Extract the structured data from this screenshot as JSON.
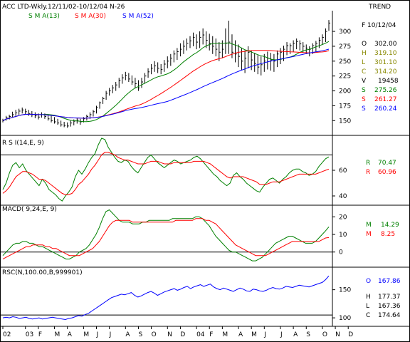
{
  "header": {
    "title": "ACC LTD-Wkly.12/11/02-10/12/04  N-26",
    "right": "TREND"
  },
  "colors": {
    "price": "#000000",
    "sma13": "#008000",
    "sma30": "#ff0000",
    "sma52": "#0000ff",
    "rsc": "#0000ff",
    "frame": "#000000",
    "background": "#ffffff"
  },
  "chart_data": [
    {
      "type": "ohlc",
      "panel": "price",
      "legend": [
        {
          "label": "S M A(13)",
          "color": "#008000"
        },
        {
          "label": "S M A(30)",
          "color": "#ff0000"
        },
        {
          "label": "S M A(52)",
          "color": "#0000ff"
        }
      ],
      "ylim": [
        130,
        330
      ],
      "y_ticks": [
        150,
        175,
        200,
        225,
        250,
        275,
        300
      ],
      "bars": [
        [
          153,
          147,
          150
        ],
        [
          158,
          150,
          155
        ],
        [
          160,
          152,
          157
        ],
        [
          165,
          155,
          160
        ],
        [
          168,
          158,
          163
        ],
        [
          170,
          160,
          166
        ],
        [
          172,
          162,
          168
        ],
        [
          170,
          160,
          165
        ],
        [
          168,
          158,
          162
        ],
        [
          166,
          156,
          160
        ],
        [
          164,
          154,
          158
        ],
        [
          162,
          152,
          156
        ],
        [
          164,
          155,
          160
        ],
        [
          162,
          153,
          157
        ],
        [
          160,
          150,
          153
        ],
        [
          158,
          147,
          150
        ],
        [
          156,
          145,
          148
        ],
        [
          153,
          143,
          146
        ],
        [
          150,
          140,
          143
        ],
        [
          148,
          139,
          142
        ],
        [
          147,
          138,
          141
        ],
        [
          150,
          140,
          146
        ],
        [
          152,
          142,
          149
        ],
        [
          155,
          145,
          151
        ],
        [
          153,
          143,
          148
        ],
        [
          156,
          147,
          153
        ],
        [
          160,
          150,
          157
        ],
        [
          164,
          153,
          160
        ],
        [
          168,
          157,
          165
        ],
        [
          175,
          162,
          172
        ],
        [
          182,
          170,
          180
        ],
        [
          190,
          178,
          187
        ],
        [
          200,
          185,
          196
        ],
        [
          205,
          192,
          200
        ],
        [
          210,
          196,
          205
        ],
        [
          215,
          200,
          210
        ],
        [
          222,
          205,
          218
        ],
        [
          228,
          212,
          222
        ],
        [
          232,
          218,
          226
        ],
        [
          230,
          215,
          220
        ],
        [
          226,
          210,
          215
        ],
        [
          222,
          205,
          212
        ],
        [
          218,
          200,
          205
        ],
        [
          222,
          205,
          215
        ],
        [
          230,
          212,
          225
        ],
        [
          238,
          222,
          232
        ],
        [
          245,
          228,
          238
        ],
        [
          250,
          232,
          242
        ],
        [
          248,
          230,
          238
        ],
        [
          245,
          228,
          236
        ],
        [
          252,
          232,
          245
        ],
        [
          258,
          238,
          250
        ],
        [
          262,
          242,
          255
        ],
        [
          268,
          248,
          262
        ],
        [
          272,
          252,
          266
        ],
        [
          280,
          258,
          270
        ],
        [
          285,
          262,
          275
        ],
        [
          288,
          268,
          280
        ],
        [
          292,
          272,
          284
        ],
        [
          298,
          275,
          290
        ],
        [
          295,
          270,
          282
        ],
        [
          300,
          272,
          290
        ],
        [
          305,
          278,
          294
        ],
        [
          300,
          272,
          285
        ],
        [
          296,
          268,
          280
        ],
        [
          292,
          262,
          275
        ],
        [
          288,
          258,
          270
        ],
        [
          282,
          250,
          265
        ],
        [
          285,
          255,
          270
        ],
        [
          305,
          262,
          280
        ],
        [
          318,
          262,
          282
        ],
        [
          295,
          255,
          265
        ],
        [
          285,
          248,
          262
        ],
        [
          278,
          240,
          258
        ],
        [
          272,
          235,
          250
        ],
        [
          268,
          230,
          255
        ],
        [
          275,
          238,
          265
        ],
        [
          268,
          235,
          252
        ],
        [
          264,
          232,
          246
        ],
        [
          260,
          228,
          240
        ],
        [
          258,
          226,
          244
        ],
        [
          262,
          232,
          250
        ],
        [
          266,
          236,
          255
        ],
        [
          264,
          234,
          252
        ],
        [
          262,
          232,
          250
        ],
        [
          268,
          240,
          262
        ],
        [
          272,
          245,
          265
        ],
        [
          276,
          250,
          270
        ],
        [
          282,
          260,
          276
        ],
        [
          280,
          262,
          276
        ],
        [
          285,
          266,
          280
        ],
        [
          288,
          270,
          283
        ],
        [
          285,
          268,
          279
        ],
        [
          282,
          264,
          275
        ],
        [
          278,
          262,
          272
        ],
        [
          275,
          258,
          270
        ],
        [
          280,
          262,
          276
        ],
        [
          284,
          266,
          280
        ],
        [
          290,
          272,
          285
        ],
        [
          295,
          278,
          290
        ],
        [
          305,
          282,
          300
        ],
        [
          319,
          301,
          314
        ]
      ],
      "current": {
        "date": "F 10/12/04",
        "O": "302.00",
        "H": "319.10",
        "L": "301.10",
        "C": "314.20",
        "V": "19458",
        "S13": "275.26",
        "S30": "261.27",
        "S52": "260.24"
      }
    },
    {
      "type": "line",
      "panel": "rsi",
      "label": "R S I(14,E, 9)",
      "ylim": [
        35,
        85
      ],
      "y_ticks": [
        40,
        60
      ],
      "reference": 72,
      "series": [
        {
          "color": "#008000",
          "values": [
            45,
            50,
            58,
            64,
            66,
            62,
            65,
            60,
            57,
            54,
            51,
            48,
            53,
            50,
            45,
            43,
            41,
            38,
            36,
            40,
            43,
            47,
            55,
            60,
            57,
            61,
            66,
            70,
            73,
            80,
            85,
            84,
            78,
            74,
            70,
            67,
            66,
            68,
            67,
            63,
            60,
            58,
            62,
            66,
            70,
            72,
            69,
            66,
            64,
            62,
            64,
            66,
            68,
            67,
            65,
            66,
            67,
            68,
            70,
            71,
            69,
            66,
            63,
            60,
            57,
            55,
            52,
            50,
            48,
            50,
            56,
            58,
            55,
            53,
            50,
            48,
            46,
            44,
            43,
            47,
            50,
            53,
            54,
            52,
            50,
            53,
            55,
            58,
            60,
            61,
            61,
            59,
            58,
            56,
            57,
            59,
            63,
            66,
            69,
            70.47
          ]
        },
        {
          "color": "#ff0000",
          "values": [
            42,
            44,
            47,
            51,
            55,
            57,
            59,
            59,
            58,
            57,
            55,
            53,
            53,
            52,
            50,
            48,
            46,
            44,
            42,
            41,
            41,
            42,
            45,
            49,
            51,
            54,
            57,
            61,
            64,
            68,
            72,
            74,
            74,
            73,
            72,
            70,
            69,
            68,
            68,
            67,
            66,
            65,
            65,
            65,
            66,
            67,
            67,
            67,
            66,
            65,
            65,
            65,
            66,
            66,
            66,
            66,
            66,
            66,
            67,
            67,
            67,
            67,
            66,
            65,
            63,
            61,
            59,
            57,
            55,
            54,
            55,
            55,
            55,
            55,
            54,
            53,
            52,
            51,
            49,
            49,
            49,
            50,
            51,
            51,
            51,
            52,
            53,
            54,
            55,
            56,
            57,
            57,
            57,
            57,
            57,
            57,
            58,
            59,
            60,
            60.96
          ]
        }
      ],
      "current": [
        {
          "label": "R",
          "value": "70.47"
        },
        {
          "label": "R",
          "value": "60.96"
        }
      ]
    },
    {
      "type": "line",
      "panel": "macd",
      "label": "MACD( 9,24,E, 9)",
      "ylim": [
        -7,
        25
      ],
      "y_ticks": [
        0,
        10,
        20
      ],
      "reference": 0,
      "series": [
        {
          "color": "#008000",
          "values": [
            -2,
            0,
            2,
            4,
            5,
            5,
            6,
            6,
            5,
            5,
            4,
            3,
            3,
            2,
            1,
            0,
            -1,
            -2,
            -3,
            -4,
            -4,
            -3,
            -2,
            0,
            1,
            2,
            4,
            7,
            10,
            14,
            19,
            23,
            24,
            22,
            20,
            18,
            17,
            17,
            17,
            16,
            16,
            16,
            17,
            17,
            18,
            18,
            18,
            18,
            18,
            18,
            18,
            19,
            19,
            19,
            19,
            19,
            19,
            19,
            20,
            20,
            19,
            17,
            15,
            12,
            9,
            7,
            5,
            3,
            1,
            0,
            0,
            -1,
            -2,
            -3,
            -4,
            -5,
            -5,
            -4,
            -3,
            -1,
            1,
            3,
            5,
            6,
            7,
            8,
            9,
            9,
            8,
            7,
            6,
            5,
            5,
            5,
            6,
            8,
            10,
            12,
            14.29
          ]
        },
        {
          "color": "#ff0000",
          "values": [
            -4,
            -3,
            -2,
            -1,
            0,
            1,
            2,
            3,
            3,
            4,
            4,
            4,
            4,
            3,
            3,
            2,
            2,
            1,
            0,
            -1,
            -2,
            -2,
            -2,
            -2,
            -1,
            0,
            1,
            2,
            4,
            6,
            9,
            12,
            15,
            17,
            18,
            18,
            18,
            18,
            18,
            17,
            17,
            17,
            17,
            17,
            17,
            17,
            17,
            17,
            17,
            17,
            17,
            17,
            18,
            18,
            18,
            18,
            18,
            18,
            19,
            19,
            19,
            18,
            18,
            17,
            16,
            14,
            12,
            10,
            8,
            6,
            4,
            3,
            2,
            1,
            0,
            -1,
            -2,
            -2,
            -2,
            -2,
            -1,
            0,
            1,
            2,
            3,
            4,
            5,
            6,
            6,
            6,
            6,
            6,
            6,
            6,
            6,
            6,
            7,
            8,
            8.25
          ]
        }
      ],
      "current": [
        {
          "label": "M",
          "value": "14.29"
        },
        {
          "label": "M",
          "value": "8.25"
        }
      ]
    },
    {
      "type": "line",
      "panel": "rsc",
      "label": "RSC(N,100.00,B,999901)",
      "ylim": [
        90,
        185
      ],
      "y_ticks": [
        100,
        150
      ],
      "reference": 105,
      "series": [
        {
          "color": "#0000ff",
          "values": [
            100,
            101,
            100,
            102,
            101,
            99,
            100,
            101,
            99,
            98,
            99,
            100,
            98,
            99,
            100,
            101,
            100,
            99,
            98,
            97,
            99,
            100,
            102,
            104,
            103,
            106,
            108,
            112,
            116,
            120,
            124,
            128,
            132,
            136,
            138,
            140,
            142,
            141,
            143,
            145,
            140,
            137,
            139,
            142,
            145,
            147,
            144,
            140,
            143,
            146,
            148,
            150,
            152,
            149,
            151,
            154,
            156,
            152,
            155,
            157,
            159,
            156,
            158,
            160,
            155,
            152,
            150,
            153,
            151,
            149,
            147,
            150,
            153,
            151,
            148,
            147,
            151,
            150,
            148,
            147,
            149,
            152,
            154,
            152,
            151,
            153,
            156,
            155,
            154,
            156,
            158,
            157,
            156,
            155,
            157,
            159,
            161,
            163,
            167.86,
            174.64
          ]
        }
      ],
      "current": {
        "O": "167.86",
        "H": "177.37",
        "L": "167.36",
        "C": "174.64"
      }
    }
  ],
  "x_axis": {
    "labels": [
      "02",
      "03",
      "F",
      "M",
      "A",
      "M",
      "J",
      "J",
      "A",
      "S",
      "O",
      "N",
      "D",
      "04",
      "F",
      "M",
      "A",
      "M",
      "J",
      "J",
      "A",
      "S",
      "O",
      "N",
      "D"
    ],
    "label_weeks": [
      0,
      7,
      11,
      16,
      20,
      25,
      29,
      33,
      38,
      42,
      46,
      51,
      55,
      60,
      64,
      68,
      73,
      77,
      81,
      86,
      90,
      94,
      99,
      103,
      107
    ]
  }
}
